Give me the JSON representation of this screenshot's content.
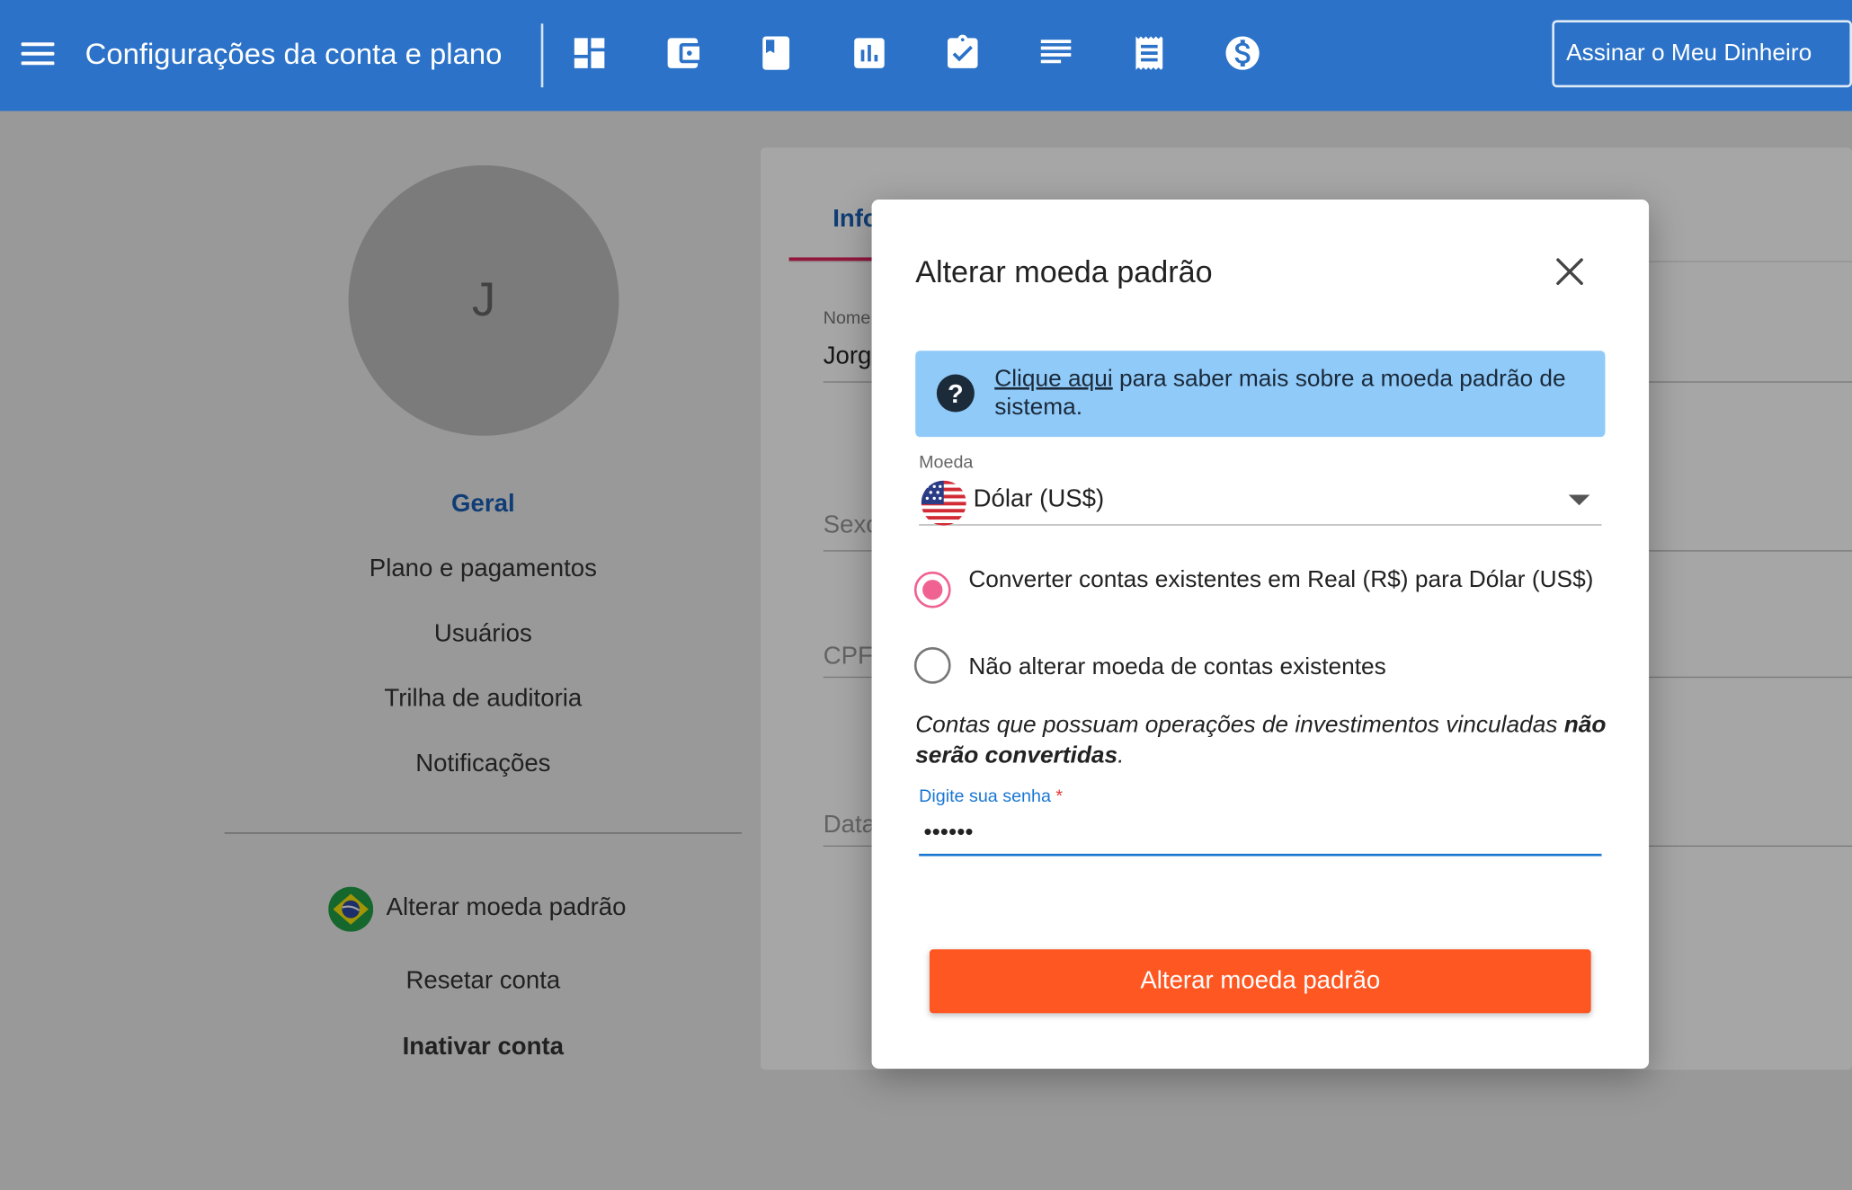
{
  "header": {
    "title": "Configurações da conta e plano",
    "subscribe_label": "Assinar o Meu Dinheiro",
    "nav_icons": [
      "dashboard-icon",
      "wallet-icon",
      "bookmark-icon",
      "bar-chart-icon",
      "clipboard-check-icon",
      "list-lines-icon",
      "receipt-icon",
      "dollar-icon"
    ]
  },
  "profile": {
    "avatar_initial": "J"
  },
  "sidebar": {
    "items": [
      "Geral",
      "Plano e pagamentos",
      "Usuários",
      "Trilha de auditoria",
      "Notificações"
    ],
    "currency_action": "Alterar moeda padrão",
    "reset": "Resetar conta",
    "deactivate": "Inativar conta"
  },
  "form": {
    "tab_label": "Info",
    "name_label": "Nome",
    "name_value": "Jorg",
    "sex_placeholder": "Sexo",
    "cpf_placeholder": "CPF",
    "date_placeholder": "Data"
  },
  "modal": {
    "title": "Alterar moeda padrão",
    "info_link": "Clique aqui",
    "info_text": " para saber mais sobre a moeda padrão de sistema.",
    "currency_label": "Moeda",
    "currency_value": "Dólar (US$)",
    "radio_convert": "Converter contas existentes em Real (R$) para Dólar (US$)",
    "radio_keep": "Não alterar moeda de contas existentes",
    "note_prefix": "Contas que possuam operações de investimentos vinculadas ",
    "note_bold": "não serão convertidas",
    "note_suffix": ".",
    "password_label": "Digite sua senha",
    "password_required": "*",
    "password_value": "••••••",
    "submit_label": "Alterar moeda padrão"
  },
  "colors": {
    "topbar": "#2b72c8",
    "info_box": "#90caf9",
    "radio_accent": "#f06292",
    "submit": "#ff5722",
    "focus": "#1976d2"
  }
}
